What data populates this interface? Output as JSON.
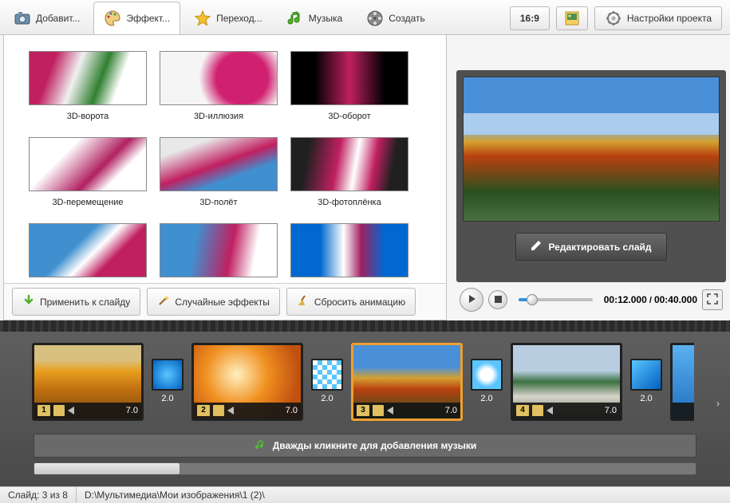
{
  "tabs": {
    "add": {
      "label": "Добавит..."
    },
    "effects": {
      "label": "Эффект..."
    },
    "trans": {
      "label": "Переход..."
    },
    "music": {
      "label": "Музыка"
    },
    "create": {
      "label": "Создать"
    }
  },
  "top": {
    "aspect": "16:9",
    "settings": "Настройки проекта"
  },
  "effects": {
    "items": [
      {
        "label": "3D-ворота"
      },
      {
        "label": "3D-иллюзия"
      },
      {
        "label": "3D-оборот"
      },
      {
        "label": "3D-перемещение"
      },
      {
        "label": "3D-полёт"
      },
      {
        "label": "3D-фотоплёнка"
      },
      {
        "label": ""
      },
      {
        "label": ""
      },
      {
        "label": ""
      }
    ],
    "apply": "Применить к слайду",
    "random": "Случайные эффекты",
    "reset": "Сбросить анимацию"
  },
  "preview": {
    "edit": "Редактировать слайд",
    "current": "00:12.000",
    "total": "00:40.000"
  },
  "timeline": {
    "slides": [
      {
        "num": "1",
        "dur": "7.0"
      },
      {
        "num": "2",
        "dur": "7.0"
      },
      {
        "num": "3",
        "dur": "7.0"
      },
      {
        "num": "4",
        "dur": "7.0"
      }
    ],
    "transitions": [
      {
        "dur": "2.0"
      },
      {
        "dur": "2.0"
      },
      {
        "dur": "2.0"
      },
      {
        "dur": "2.0"
      }
    ],
    "music_hint": "Дважды кликните для добавления музыки"
  },
  "status": {
    "slide": "Слайд: 3 из 8",
    "path": "D:\\Мультимедиа\\Мои изображения\\1 (2)\\"
  }
}
